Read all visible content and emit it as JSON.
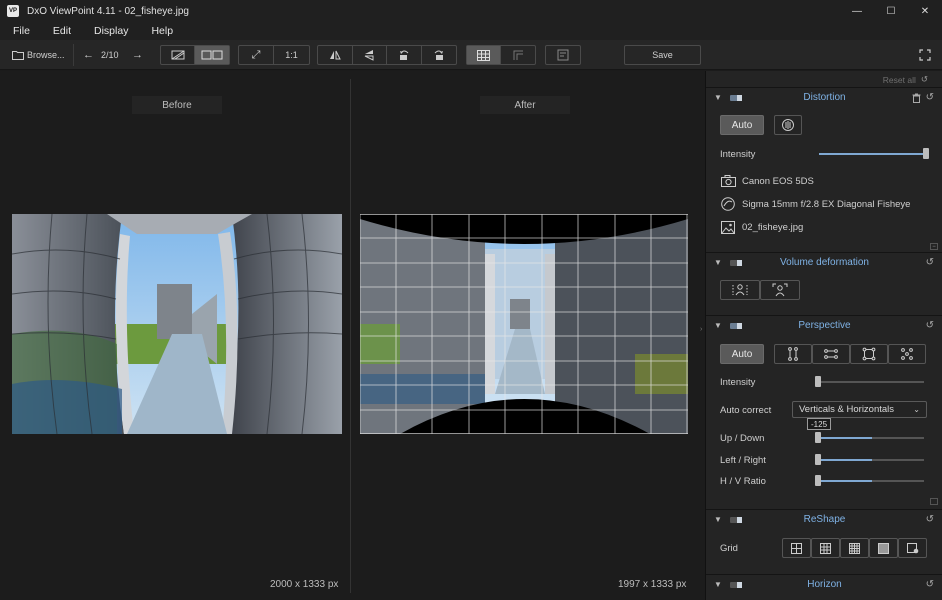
{
  "window": {
    "app_icon_text": "VP",
    "title": "DxO ViewPoint 4.11 - 02_fisheye.jpg",
    "minimize": "—",
    "maximize": "☐",
    "close": "✕"
  },
  "menu": [
    "File",
    "Edit",
    "Display",
    "Help"
  ],
  "toolbar": {
    "browse_label": "Browse...",
    "prev": "←",
    "next": "→",
    "page_counter": "2/10",
    "zoom_fit": "⤢",
    "zoom_1to1": "1:1",
    "save_label": "Save",
    "fullscreen": "⤢"
  },
  "viewer": {
    "before_label": "Before",
    "after_label": "After",
    "before_dims": "2000 x 1333 px",
    "after_dims": "1997 x 1333 px"
  },
  "sidebar": {
    "reset_all": "Reset all",
    "reset_icon": "↺",
    "distortion": {
      "title": "Distortion",
      "auto_label": "Auto",
      "intensity_label": "Intensity",
      "intensity_value": 1.0,
      "camera": "Canon EOS 5DS",
      "lens": "Sigma 15mm f/2.8 EX Diagonal Fisheye",
      "file": "02_fisheye.jpg"
    },
    "volume": {
      "title": "Volume deformation"
    },
    "perspective": {
      "title": "Perspective",
      "auto_label": "Auto",
      "intensity_label": "Intensity",
      "auto_correct_label": "Auto correct",
      "auto_correct_value": "Verticals & Horizontals",
      "updown_label": "Up / Down",
      "updown_tooltip": "-125",
      "leftright_label": "Left / Right",
      "hv_label": "H / V Ratio"
    },
    "reshape": {
      "title": "ReShape",
      "grid_label": "Grid"
    },
    "horizon": {
      "title": "Horizon"
    }
  },
  "colors": {
    "accent": "#7fb2e5",
    "slider_fill": "#7fa8d2"
  },
  "icons": [
    "camera-icon",
    "lens-icon",
    "image-file-icon",
    "trash-icon",
    "reset-icon",
    "chevron-down-icon"
  ]
}
